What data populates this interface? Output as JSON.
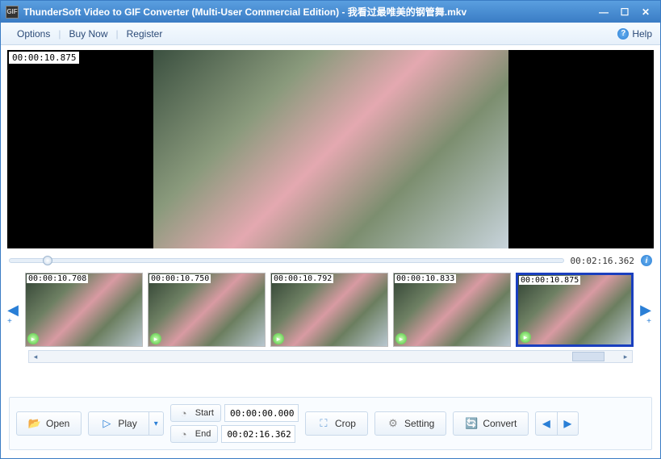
{
  "window": {
    "title": "ThunderSoft Video to GIF Converter (Multi-User Commercial Edition) - 我看过最唯美的钢管舞.mkv"
  },
  "menubar": {
    "options": "Options",
    "buyNow": "Buy Now",
    "register": "Register",
    "help": "Help"
  },
  "preview": {
    "timestamp": "00:00:10.875",
    "duration": "00:02:16.362"
  },
  "thumbnails": [
    {
      "ts": "00:00:10.708",
      "selected": false
    },
    {
      "ts": "00:00:10.750",
      "selected": false
    },
    {
      "ts": "00:00:10.792",
      "selected": false
    },
    {
      "ts": "00:00:10.833",
      "selected": false
    },
    {
      "ts": "00:00:10.875",
      "selected": true
    }
  ],
  "toolbar": {
    "open": "Open",
    "play": "Play",
    "start": "Start",
    "end": "End",
    "startTime": "00:00:00.000",
    "endTime": "00:02:16.362",
    "crop": "Crop",
    "setting": "Setting",
    "convert": "Convert"
  },
  "icons": {
    "appIcon": "GIF",
    "helpGlyph": "?",
    "infoGlyph": "i",
    "clockGlyph": "▸",
    "folderGlyph": "📂",
    "playGlyph": "▷",
    "timeGlyph": "◔",
    "cropGlyph": "⛶",
    "gearGlyph": "⚙",
    "convertGlyph": "🔄",
    "leftGlyph": "◀",
    "rightGlyph": "▶",
    "smLeftGlyph": "◂",
    "smRightGlyph": "▸",
    "dropGlyph": "▾",
    "minGlyph": "—",
    "maxGlyph": "☐",
    "closeGlyph": "✕",
    "plusGlyph": "+"
  }
}
